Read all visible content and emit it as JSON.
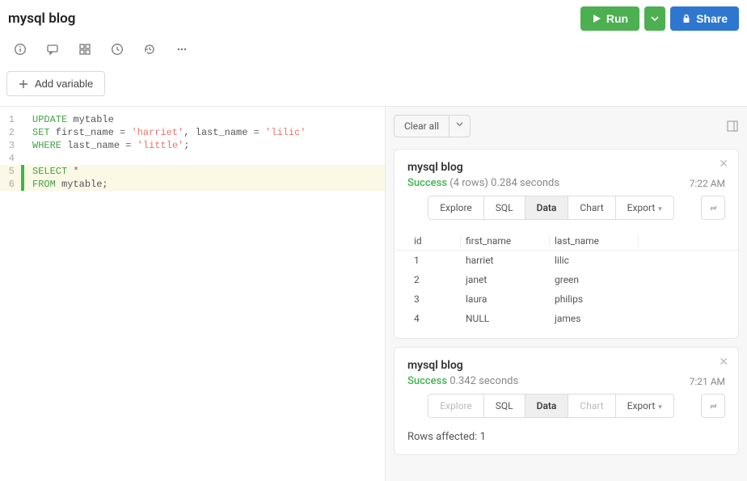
{
  "title": "mysql blog",
  "buttons": {
    "run": "Run",
    "share": "Share",
    "add_variable": "Add variable",
    "clear_all": "Clear all"
  },
  "editor": {
    "lines": [
      {
        "n": "1",
        "marker": false,
        "hl": false,
        "segments": [
          {
            "t": "UPDATE",
            "c": "kw"
          },
          {
            "t": " mytable",
            "c": "tbl"
          }
        ]
      },
      {
        "n": "2",
        "marker": false,
        "hl": false,
        "segments": [
          {
            "t": "SET",
            "c": "kw"
          },
          {
            "t": " first_name ",
            "c": "tbl"
          },
          {
            "t": "=",
            "c": "op"
          },
          {
            "t": " ",
            "c": "tbl"
          },
          {
            "t": "'harriet'",
            "c": "str"
          },
          {
            "t": ", last_name ",
            "c": "tbl"
          },
          {
            "t": "=",
            "c": "op"
          },
          {
            "t": " ",
            "c": "tbl"
          },
          {
            "t": "'lilic'",
            "c": "str"
          }
        ]
      },
      {
        "n": "3",
        "marker": false,
        "hl": false,
        "segments": [
          {
            "t": "WHERE",
            "c": "kw"
          },
          {
            "t": " last_name ",
            "c": "tbl"
          },
          {
            "t": "=",
            "c": "op"
          },
          {
            "t": " ",
            "c": "tbl"
          },
          {
            "t": "'little'",
            "c": "str"
          },
          {
            "t": ";",
            "c": "tbl"
          }
        ]
      },
      {
        "n": "4",
        "marker": false,
        "hl": false,
        "segments": []
      },
      {
        "n": "5",
        "marker": true,
        "hl": true,
        "segments": [
          {
            "t": "SELECT",
            "c": "kw"
          },
          {
            "t": " ",
            "c": "tbl"
          },
          {
            "t": "*",
            "c": "op"
          }
        ]
      },
      {
        "n": "6",
        "marker": true,
        "hl": true,
        "segments": [
          {
            "t": "FROM",
            "c": "kw"
          },
          {
            "t": " mytable;",
            "c": "tbl"
          }
        ]
      }
    ]
  },
  "results": [
    {
      "title": "mysql blog",
      "status_label": "Success",
      "status_detail": "(4 rows) 0.284 seconds",
      "time": "7:22 AM",
      "tabs": [
        {
          "label": "Explore",
          "active": false,
          "disabled": false
        },
        {
          "label": "SQL",
          "active": false,
          "disabled": false
        },
        {
          "label": "Data",
          "active": true,
          "disabled": false
        },
        {
          "label": "Chart",
          "active": false,
          "disabled": false
        },
        {
          "label": "Export",
          "active": false,
          "disabled": false,
          "chev": true
        }
      ],
      "columns": [
        "id",
        "first_name",
        "last_name"
      ],
      "rows": [
        [
          "1",
          "harriet",
          "lilic"
        ],
        [
          "2",
          "janet",
          "green"
        ],
        [
          "3",
          "laura",
          "philips"
        ],
        [
          "4",
          "NULL",
          "james"
        ]
      ]
    },
    {
      "title": "mysql blog",
      "status_label": "Success",
      "status_detail": "0.342 seconds",
      "time": "7:21 AM",
      "tabs": [
        {
          "label": "Explore",
          "active": false,
          "disabled": true
        },
        {
          "label": "SQL",
          "active": false,
          "disabled": false
        },
        {
          "label": "Data",
          "active": true,
          "disabled": false
        },
        {
          "label": "Chart",
          "active": false,
          "disabled": true
        },
        {
          "label": "Export",
          "active": false,
          "disabled": false,
          "chev": true
        }
      ],
      "rows_affected": "Rows affected: 1"
    }
  ]
}
